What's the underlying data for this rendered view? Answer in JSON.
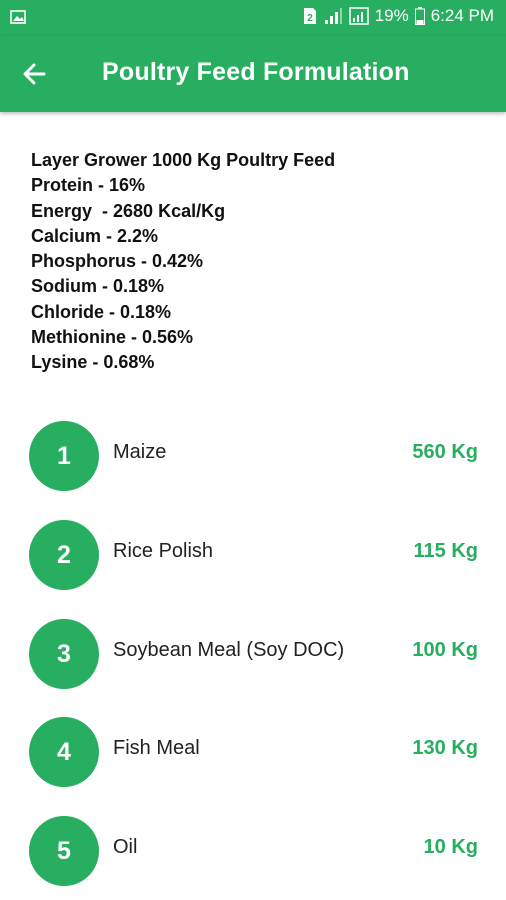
{
  "status_bar": {
    "battery": "19%",
    "time": "6:24 PM",
    "icons": [
      "image-icon",
      "sim-icon",
      "signal-icon",
      "signal-icon-2",
      "battery-icon"
    ]
  },
  "app_bar": {
    "title": "Poultry Feed Formulation",
    "back_icon": "arrow-back-icon",
    "color": "#27ae60"
  },
  "info": {
    "heading": "Layer Grower 1000 Kg Poultry Feed",
    "lines": [
      "Protein - 16%",
      "Energy  - 2680 Kcal/Kg",
      "Calcium - 2.2%",
      "Phosphorus - 0.42%",
      "Sodium - 0.18%",
      "Chloride - 0.18%",
      "Methionine - 0.56%",
      "Lysine - 0.68%"
    ]
  },
  "ingredients": [
    {
      "num": "1",
      "name": "Maize",
      "qty": "560 Kg"
    },
    {
      "num": "2",
      "name": "Rice Polish",
      "qty": "115 Kg"
    },
    {
      "num": "3",
      "name": "Soybean Meal (Soy DOC)",
      "qty": "100 Kg"
    },
    {
      "num": "4",
      "name": "Fish Meal",
      "qty": "130 Kg"
    },
    {
      "num": "5",
      "name": "Oil",
      "qty": "10 Kg"
    }
  ]
}
